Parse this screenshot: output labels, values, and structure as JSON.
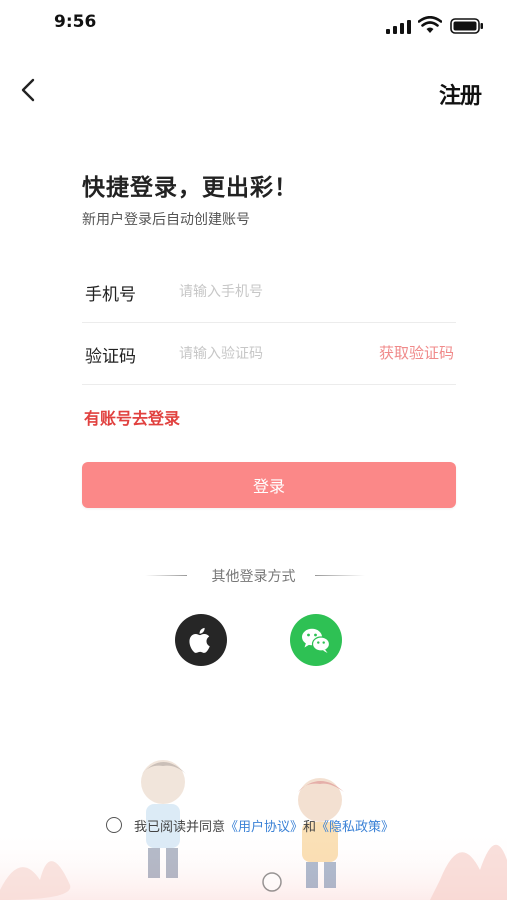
{
  "status_bar": {
    "time": "9:56"
  },
  "nav": {
    "register": "注册"
  },
  "header": {
    "title": "快捷登录，更出彩！",
    "subtitle": "新用户登录后自动创建账号"
  },
  "phone": {
    "label": "手机号",
    "placeholder": "请输入手机号",
    "value": ""
  },
  "code": {
    "label": "验证码",
    "placeholder": "请输入验证码",
    "value": "",
    "get_code": "获取验证码"
  },
  "has_account": "有账号去登录",
  "login_button": "登录",
  "other_login": {
    "label": "其他登录方式",
    "apple_icon": "apple-icon",
    "wechat_icon": "wechat-icon"
  },
  "agreement": {
    "prefix": "我已阅读并同意",
    "user_agreement": "《用户协议》",
    "and": "和",
    "privacy_policy": "《隐私政策》",
    "checked": false
  },
  "colors": {
    "accent": "#fb8888",
    "link_red": "#e1413f",
    "link_blue": "#3b82d6",
    "wechat": "#2ec154"
  }
}
